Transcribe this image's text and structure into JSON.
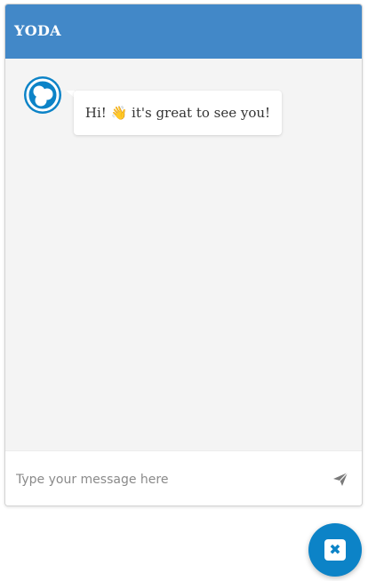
{
  "header": {
    "title": "YODA"
  },
  "conversation": {
    "messages": [
      {
        "sender": "bot",
        "avatar_icon": "bot-avatar-icon",
        "text": "Hi! 👋 it's great to see you!"
      }
    ]
  },
  "composer": {
    "placeholder": "Type your message here",
    "value": "",
    "send_icon": "send-icon"
  },
  "launcher": {
    "icon": "close-icon",
    "glyph": "✖"
  },
  "colors": {
    "header_bg": "#4288c8",
    "accent": "#0c83c7",
    "messages_bg": "#f4f4f4"
  }
}
